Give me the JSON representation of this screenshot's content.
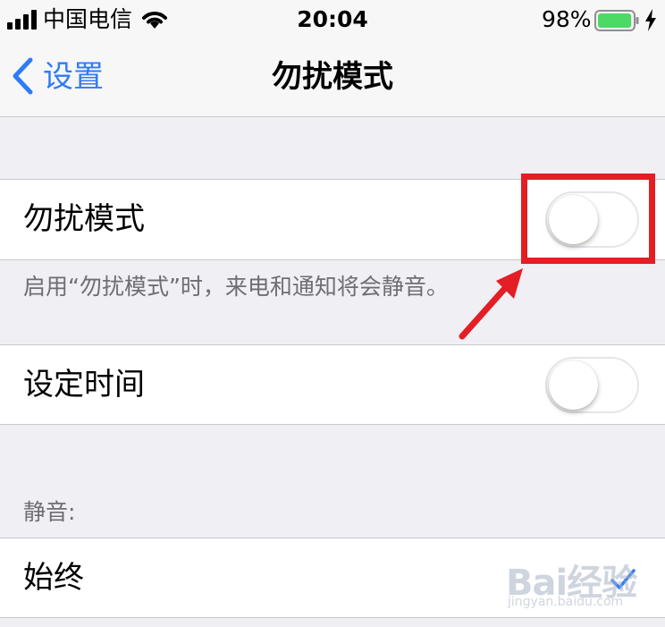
{
  "status_bar": {
    "carrier": "中国电信",
    "time": "20:04",
    "battery_percent": "98%",
    "battery_level": 0.98,
    "battery_color": "#4cd964",
    "icons": [
      "signal-icon",
      "wifi-icon",
      "battery-icon",
      "charging-icon"
    ]
  },
  "nav": {
    "back_label": "设置",
    "title": "勿扰模式",
    "accent_color": "#2f7cf6"
  },
  "settings": {
    "dnd": {
      "label": "勿扰模式",
      "enabled": false
    },
    "dnd_footer": "启用“勿扰模式”时，来电和通知将会静音。",
    "scheduled": {
      "label": "设定时间",
      "enabled": false
    },
    "silence_header": "静音:",
    "silence_options": [
      {
        "label": "始终",
        "selected": true
      }
    ]
  },
  "annotation": {
    "color": "#e31e24"
  },
  "watermark": {
    "logo": "Bai经验",
    "url": "jingyan.baidu.com"
  }
}
